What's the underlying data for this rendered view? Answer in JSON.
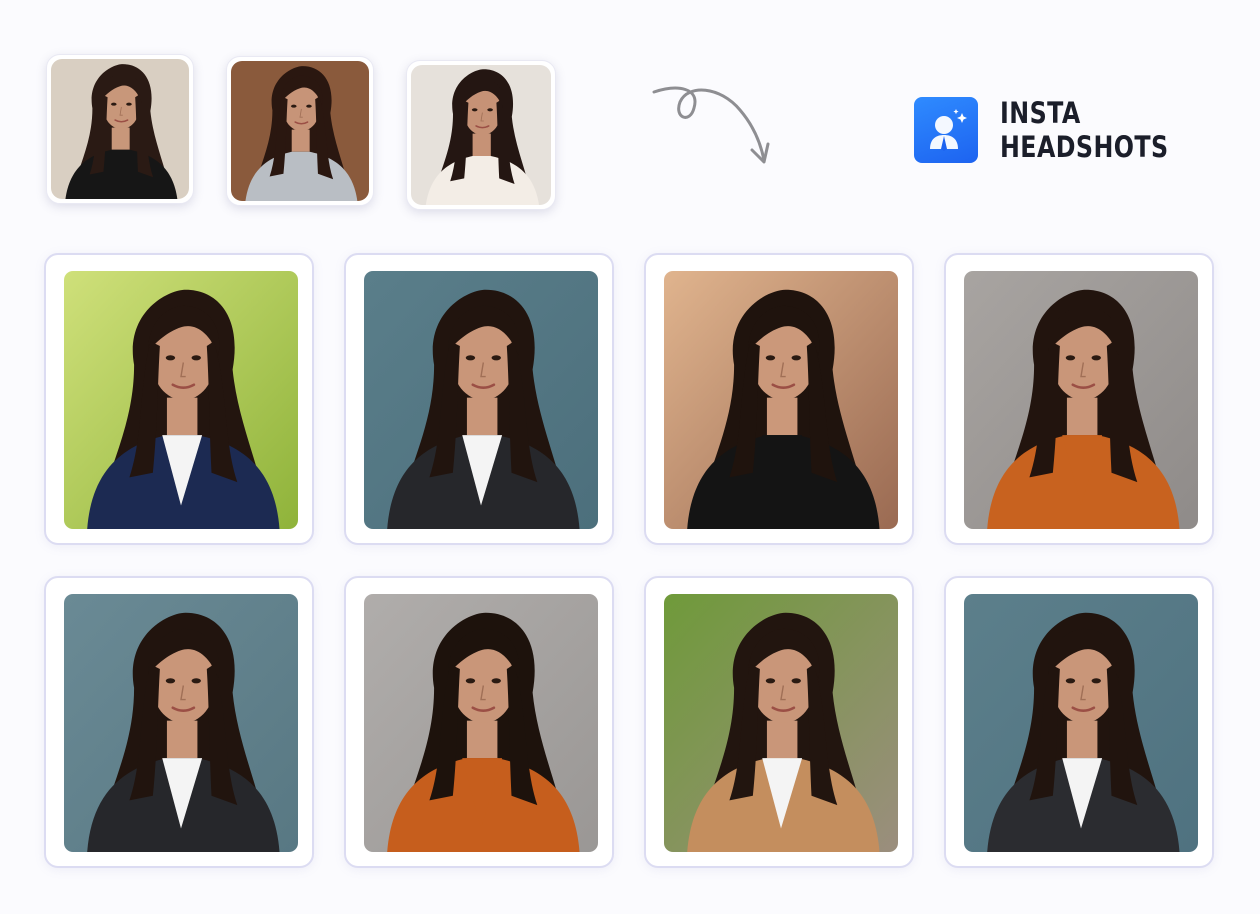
{
  "brand": {
    "name": "INSTA HEADSHOTS",
    "logo_icon": "person-sparkle-icon",
    "accent": "#2a7af8"
  },
  "arrow_icon": "curly-arrow-icon",
  "inputs": [
    {
      "label": "input-selfie-1",
      "bg": "#d9cfc2",
      "hair": "#2a1a14",
      "top": "#161616",
      "skin": "#c8977a"
    },
    {
      "label": "input-selfie-2",
      "bg": "#8a5a3c",
      "hair": "#2a1710",
      "top": "#b9bec4",
      "skin": "#c79478"
    },
    {
      "label": "input-selfie-3",
      "bg": "#e6e1db",
      "hair": "#241612",
      "top": "#f3ede6",
      "skin": "#c69276"
    }
  ],
  "headshots": [
    {
      "label": "headshot-park-navy-blazer",
      "bg": "#8fb33a",
      "bg2": "#cfe07a",
      "hair": "#23150f",
      "jacket": "#1c2a52",
      "shirt": "#f4f4f4",
      "skin": "#c99679"
    },
    {
      "label": "headshot-teal-black-blazer",
      "bg": "#4c6f7c",
      "bg2": "#5a7e8a",
      "hair": "#21140e",
      "jacket": "#26272b",
      "shirt": "#f4f4f4",
      "skin": "#c99679"
    },
    {
      "label": "headshot-office-turtleneck",
      "bg": "#9a6a52",
      "bg2": "#e0b48e",
      "hair": "#1f130d",
      "jacket": "#141414",
      "shirt": "#141414",
      "skin": "#cb987a"
    },
    {
      "label": "headshot-grey-orange-sweater",
      "bg": "#8f8b89",
      "bg2": "#a8a4a1",
      "hair": "#22140e",
      "jacket": "#c8621f",
      "shirt": "#c8621f",
      "skin": "#c99679"
    },
    {
      "label": "headshot-teal-black-blazer-2",
      "bg": "#587883",
      "bg2": "#6a8a95",
      "hair": "#21140e",
      "jacket": "#26272b",
      "shirt": "#f4f4f4",
      "skin": "#c99679"
    },
    {
      "label": "headshot-grey-orange-sweater-2",
      "bg": "#9a9795",
      "bg2": "#b0adab",
      "hair": "#1d120c",
      "jacket": "#c65e1d",
      "shirt": "#c65e1d",
      "skin": "#c99679"
    },
    {
      "label": "headshot-street-tan-coat",
      "bg": "#9b8e7e",
      "bg2": "#6f9a3a",
      "hair": "#22150f",
      "jacket": "#c48e5e",
      "shirt": "#f4f4f4",
      "skin": "#c99679"
    },
    {
      "label": "headshot-teal-grey-blazer",
      "bg": "#4f7280",
      "bg2": "#5c7f8b",
      "hair": "#21140e",
      "jacket": "#2b2c30",
      "shirt": "#f4f4f4",
      "skin": "#c99679"
    }
  ]
}
